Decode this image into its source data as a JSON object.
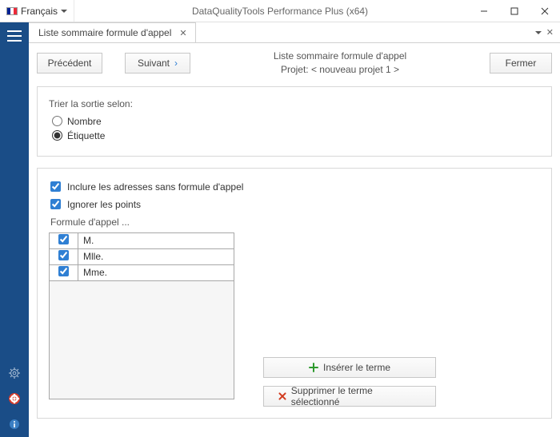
{
  "titlebar": {
    "language_label": "Français",
    "app_title": "DataQualityTools Performance Plus (x64)"
  },
  "tab": {
    "title": "Liste sommaire formule d'appel"
  },
  "toolbar": {
    "prev_label": "Précédent",
    "next_label": "Suivant",
    "close_label": "Fermer",
    "header_line1": "Liste sommaire formule d'appel",
    "header_line2": "Projet: < nouveau projet 1 >"
  },
  "sort_panel": {
    "heading": "Trier la sortie selon:",
    "option_number": "Nombre",
    "option_label": "Étiquette",
    "selected": "label"
  },
  "options": {
    "include_no_salutation": {
      "label": "Inclure les adresses sans formule d'appel",
      "checked": true
    },
    "ignore_dots": {
      "label": "Ignorer les points",
      "checked": true
    }
  },
  "table": {
    "heading": "Formule d'appel ...",
    "rows": [
      {
        "checked": true,
        "value": "M."
      },
      {
        "checked": true,
        "value": "Mlle."
      },
      {
        "checked": true,
        "value": "Mme."
      }
    ]
  },
  "actions": {
    "insert_label": "Insérer le terme",
    "delete_label": "Supprimer le terme sélectionné"
  }
}
